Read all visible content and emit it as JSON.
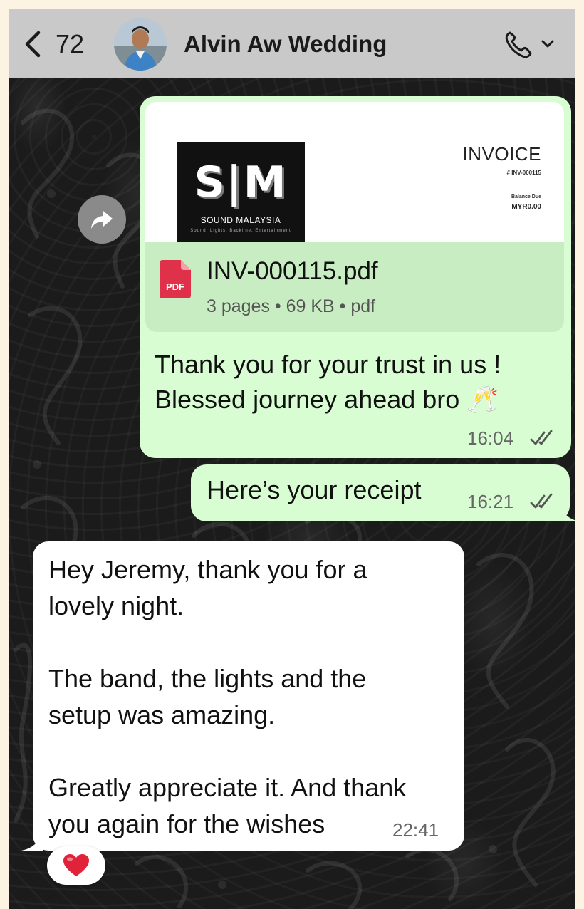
{
  "header": {
    "back_count": "72",
    "title": "Alvin Aw Wedding",
    "icons": [
      "back-chevron-icon",
      "contact-avatar",
      "phone-icon",
      "chevron-down-icon"
    ]
  },
  "messages": [
    {
      "direction": "outgoing",
      "attachment": {
        "preview": {
          "logo_mark": "S|M",
          "logo_name": "SOUND MALAYSIA",
          "logo_tagline": "Sound, Lights, Backline, Entertainment",
          "doc_title": "INVOICE",
          "doc_number": "# INV-000115",
          "balance_label": "Balance Due",
          "balance_value": "MYR0.00"
        },
        "file_name": "INV-000115.pdf",
        "file_meta": "3 pages • 69 KB • pdf",
        "icon_label": "PDF"
      },
      "text": "Thank you for your trust in us !\nBlessed journey ahead bro 🥂",
      "time": "16:04",
      "status": "read"
    },
    {
      "direction": "outgoing",
      "text": "Here’s your receipt",
      "time": "16:21",
      "status": "read"
    },
    {
      "direction": "incoming",
      "text": "Hey Jeremy, thank you for a\nlovely night.\n\nThe band, the lights and the\nsetup was amazing.\n\nGreatly appreciate it. And thank\nyou again for the wishes",
      "time": "22:41",
      "reaction": "❤️"
    }
  ],
  "colors": {
    "outgoing_bubble": "#d9fdd3",
    "incoming_bubble": "#ffffff",
    "header_bg": "#c9c9c9",
    "pdf_red": "#e0314b",
    "page_bg": "#fdf3e3"
  }
}
